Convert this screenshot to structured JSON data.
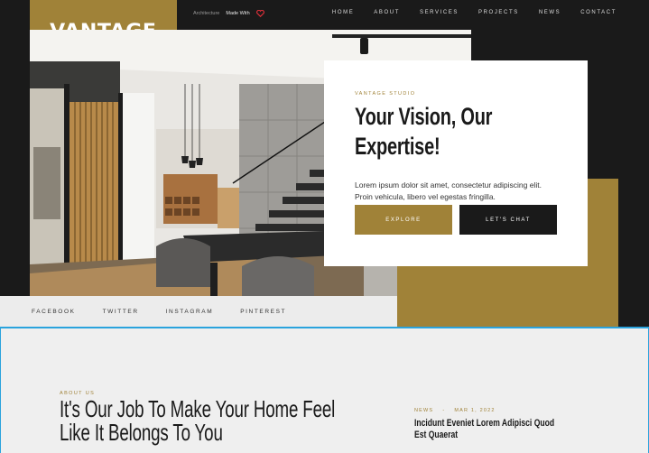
{
  "brand": {
    "logo_text": "VANTAGE"
  },
  "top_meta": {
    "left": "Architecture",
    "right": "Made With"
  },
  "nav": {
    "items": [
      "HOME",
      "ABOUT",
      "SERVICES",
      "PROJECTS",
      "NEWS",
      "CONTACT"
    ]
  },
  "hero": {
    "eyebrow": "VANTAGE STUDIO",
    "title": "Your Vision, Our Expertise!",
    "body": "Lorem ipsum dolor sit amet, consectetur adipiscing elit. Proin vehicula, libero vel egestas fringilla.",
    "primary_button": "EXPLORE",
    "secondary_button": "LET'S CHAT"
  },
  "socials": [
    "FACEBOOK",
    "TWITTER",
    "INSTAGRAM",
    "PINTEREST"
  ],
  "about": {
    "eyebrow": "ABOUT US",
    "title": "It's Our Job To Make Your Home Feel Like It Belongs To You"
  },
  "news": {
    "category": "NEWS",
    "separator": "-",
    "date": "MAR 1, 2022",
    "title": "Incidunt Eveniet Lorem Adipisci Quod Est Quaerat"
  },
  "colors": {
    "gold": "#a08238",
    "dark": "#1a1a1a",
    "light": "#efefef",
    "accent_line": "#2aa3dd"
  }
}
